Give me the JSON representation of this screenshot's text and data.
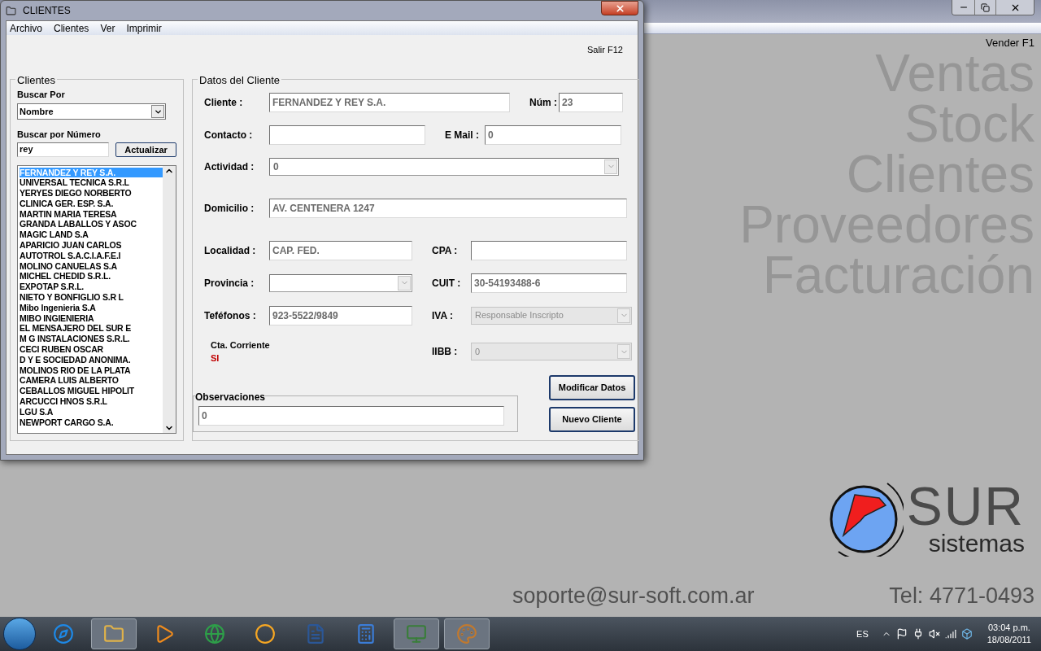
{
  "main_window": {
    "shortcut": "Vender F1",
    "modules": [
      "Ventas",
      "Stock",
      "Clientes",
      "Proveedores",
      "Facturación"
    ],
    "logo": {
      "name": "SUR",
      "tagline": "sistemas"
    },
    "email": "soporte@sur-soft.com.ar",
    "phone": "Tel: 4771-0493"
  },
  "dialog": {
    "title": "CLIENTES",
    "menu": [
      "Archivo",
      "Clientes",
      "Ver",
      "Imprimir"
    ],
    "shortcut": "Salir F12",
    "search": {
      "title": "Clientes",
      "by_label": "Buscar Por",
      "by_value": "Nombre",
      "number_label": "Buscar por Número",
      "number_value": "rey",
      "button": "Actualizar",
      "results": [
        {
          "name": "FERNANDEZ Y REY S.A.",
          "selected": true
        },
        {
          "name": "UNIVERSAL TECNICA S.R.L",
          "selected": false
        },
        {
          "name": "YERYES DIEGO NORBERTO",
          "selected": false
        },
        {
          "name": "CLINICA GER. ESP. S.A.",
          "selected": false
        },
        {
          "name": "MARTIN MARIA TERESA",
          "selected": false
        },
        {
          "name": "GRANDA LABALLOS Y ASOC",
          "selected": false
        },
        {
          "name": "MAGIC LAND S.A",
          "selected": false
        },
        {
          "name": "APARICIO JUAN CARLOS",
          "selected": false
        },
        {
          "name": "AUTOTROL S.A.C.I.A.F.E.I",
          "selected": false
        },
        {
          "name": "MOLINO CANUELAS S.A",
          "selected": false
        },
        {
          "name": "MICHEL CHEDID S.R.L.",
          "selected": false
        },
        {
          "name": "EXPOTAP S.R.L.",
          "selected": false
        },
        {
          "name": "NIETO Y BONFIGLIO S.R L",
          "selected": false
        },
        {
          "name": "Mibo Ingenieria S.A",
          "selected": false
        },
        {
          "name": "MIBO INGIENIERIA",
          "selected": false
        },
        {
          "name": "EL MENSAJERO DEL SUR E",
          "selected": false
        },
        {
          "name": "M G INSTALACIONES S.R.L.",
          "selected": false
        },
        {
          "name": "CECI RUBEN OSCAR",
          "selected": false
        },
        {
          "name": "D Y E SOCIEDAD ANONIMA.",
          "selected": false
        },
        {
          "name": "MOLINOS RIO DE LA PLATA",
          "selected": false
        },
        {
          "name": "CAMERA LUIS ALBERTO",
          "selected": false
        },
        {
          "name": "CEBALLOS MIGUEL HIPOLIT",
          "selected": false
        },
        {
          "name": "ARCUCCI HNOS S.R.L",
          "selected": false
        },
        {
          "name": "LGU S.A",
          "selected": false
        },
        {
          "name": "NEWPORT CARGO S.A.",
          "selected": false
        }
      ]
    },
    "details": {
      "title": "Datos del Cliente",
      "rows": [
        [
          {
            "kind": "text",
            "label": "Cliente :",
            "value": "FERNANDEZ Y REY S.A.",
            "disabled": false
          },
          {
            "kind": "text",
            "label": "Núm :",
            "value": "23",
            "disabled": false
          }
        ],
        [
          {
            "kind": "text",
            "label": "Contacto :",
            "disabled": false
          },
          {
            "kind": "text",
            "label": "E Mail :",
            "value": "0",
            "disabled": false
          }
        ],
        [
          {
            "kind": "combo",
            "label": "Actividad :",
            "value": "0",
            "disabled": false
          }
        ],
        [
          {
            "kind": "text",
            "label": "Domicilio :",
            "value": "AV. CENTENERA 1247",
            "disabled": false
          }
        ],
        [
          {
            "kind": "text",
            "label": "Localidad :",
            "value": "CAP. FED.",
            "disabled": false
          },
          {
            "kind": "text",
            "label": "CPA :",
            "disabled": false
          }
        ],
        [
          {
            "kind": "combo",
            "label": "Provincia :",
            "disabled": false
          },
          {
            "kind": "text",
            "label": "CUIT :",
            "value": "30-54193488-6",
            "disabled": false
          }
        ],
        [
          {
            "kind": "text",
            "label": "Teféfonos :",
            "value": "923-5522/9849",
            "disabled": false
          },
          {
            "kind": "combo",
            "label": "IVA :",
            "value": "Responsable Inscripto",
            "disabled": true
          }
        ],
        [
          {
            "kind": "status",
            "label": "Cta. Corriente",
            "value": "SI",
            "disabled": false
          },
          {
            "kind": "combo",
            "label": "IIBB :",
            "value": "0",
            "disabled": true
          }
        ]
      ],
      "notes": {
        "title": "Observaciones",
        "value": "0"
      },
      "buttons": [
        "Modificar Datos",
        "Nuevo Cliente"
      ]
    }
  },
  "taskbar": {
    "apps": [
      {
        "kind": "browser",
        "running": false
      },
      {
        "kind": "folder",
        "running": true
      },
      {
        "kind": "media",
        "running": false
      },
      {
        "kind": "globe",
        "running": false
      },
      {
        "kind": "player",
        "running": false
      },
      {
        "kind": "word",
        "running": false
      },
      {
        "kind": "calculator",
        "running": false
      },
      {
        "kind": "app",
        "running": true
      },
      {
        "kind": "paint",
        "running": true
      }
    ],
    "language": "ES",
    "time": "03:04 p.m.",
    "date": "18/08/2011"
  }
}
